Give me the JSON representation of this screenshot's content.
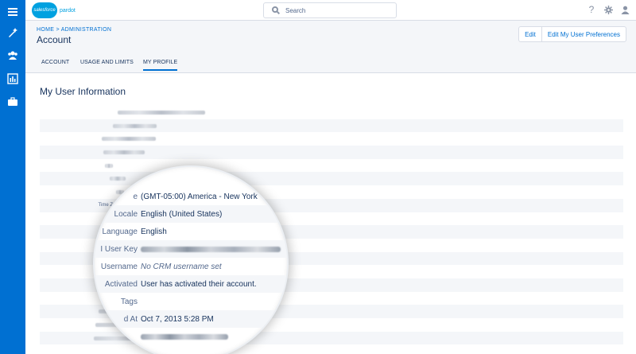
{
  "nav": [
    {
      "icon": "menu-icon"
    },
    {
      "icon": "wand-icon"
    },
    {
      "icon": "users-icon"
    },
    {
      "icon": "reports-icon"
    },
    {
      "icon": "briefcase-icon"
    }
  ],
  "topbar": {
    "logo_text": "salesforce",
    "product": "pardot",
    "search_placeholder": "Search",
    "icons": [
      "help-icon",
      "settings-icon",
      "user-icon"
    ]
  },
  "header": {
    "breadcrumb": "HOME > ADMINISTRATION",
    "title": "Account",
    "buttons": {
      "edit": "Edit",
      "edit_prefs": "Edit My User Preferences"
    }
  },
  "tabs": [
    {
      "label": "ACCOUNT",
      "active": false
    },
    {
      "label": "USAGE AND LIMITS",
      "active": false
    },
    {
      "label": "MY PROFILE",
      "active": true
    }
  ],
  "section_title": "My User Information",
  "rows": [
    {
      "label": ""
    },
    {
      "label": ""
    },
    {
      "label": ""
    },
    {
      "label": ""
    },
    {
      "label": ""
    },
    {
      "label": ""
    },
    {
      "label": ""
    },
    {
      "label": "Time Zone"
    },
    {
      "label": "Locale"
    },
    {
      "label": "Language"
    },
    {
      "label": "API User"
    },
    {
      "label": "CRM Usern"
    },
    {
      "label": "Activ"
    },
    {
      "label": ""
    },
    {
      "label": "Created"
    },
    {
      "label": ""
    },
    {
      "label": ""
    },
    {
      "label": ""
    }
  ],
  "magnified": [
    {
      "label": "e",
      "value": "(GMT-05:00) America - New York"
    },
    {
      "label": "Locale",
      "value": "English (United States)"
    },
    {
      "label": "Language",
      "value": "English"
    },
    {
      "label": "I User Key",
      "value": ""
    },
    {
      "label": "Username",
      "value": "No CRM username set"
    },
    {
      "label": "Activated",
      "value": "User has activated their account."
    },
    {
      "label": "Tags",
      "value": ""
    },
    {
      "label": "d At",
      "value": "Oct 7, 2013 5:28 PM"
    },
    {
      "label": "",
      "value": ""
    }
  ]
}
